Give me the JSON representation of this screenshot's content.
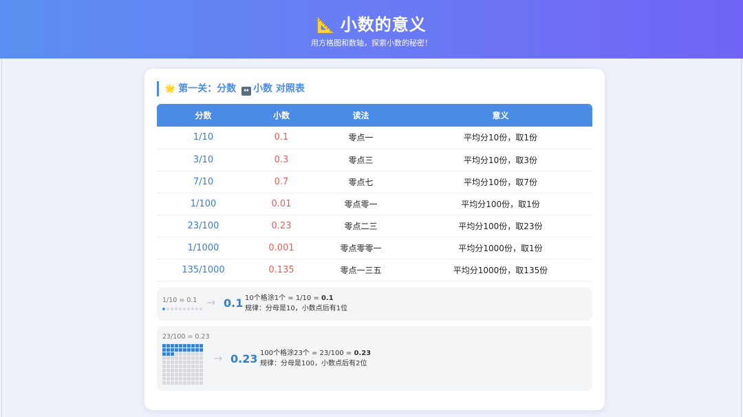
{
  "header": {
    "icon": "triangle-ruler-icon",
    "icon_glyph": "📐",
    "title": "小数的意义",
    "subtitle": "用方格图和数轴，探索小数的秘密！"
  },
  "section": {
    "star_glyph": "🌟",
    "arrow_glyph": "↔",
    "title_a": "第一关：分数",
    "title_b": "小数 对照表"
  },
  "table": {
    "headers": [
      "分数",
      "小数",
      "读法",
      "意义"
    ],
    "rows": [
      {
        "fraction": "1/10",
        "decimal": "0.1",
        "reading": "零点一",
        "meaning": "平均分10份，取1份"
      },
      {
        "fraction": "3/10",
        "decimal": "0.3",
        "reading": "零点三",
        "meaning": "平均分10份，取3份"
      },
      {
        "fraction": "7/10",
        "decimal": "0.7",
        "reading": "零点七",
        "meaning": "平均分10份，取7份"
      },
      {
        "fraction": "1/100",
        "decimal": "0.01",
        "reading": "零点零一",
        "meaning": "平均分100份，取1份"
      },
      {
        "fraction": "23/100",
        "decimal": "0.23",
        "reading": "零点二三",
        "meaning": "平均分100份，取23份"
      },
      {
        "fraction": "1/1000",
        "decimal": "0.001",
        "reading": "零点零零一",
        "meaning": "平均分1000份，取1份"
      },
      {
        "fraction": "135/1000",
        "decimal": "0.135",
        "reading": "零点一三五",
        "meaning": "平均分1000份，取135份"
      }
    ]
  },
  "demo1": {
    "label": "1/10 = 0.1",
    "arrow": "→",
    "result": "0.1",
    "line1_prefix": "10个格涂1个 = 1/10 = ",
    "line1_value": "0.1",
    "line2": "规律：分母是10，小数点后有1位",
    "shaded": 1,
    "total": 10
  },
  "demo2": {
    "label": "23/100 = 0.23",
    "arrow": "→",
    "result": "0.23",
    "line1_prefix": "100个格涂23个 = 23/100 = ",
    "line1_value": "0.23",
    "line2": "规律：分母是100，小数点后有2位",
    "shaded": 23,
    "total": 100
  },
  "colors": {
    "accent": "#4a8be6",
    "fraction": "#3b7dc4",
    "decimal": "#e0605c"
  }
}
